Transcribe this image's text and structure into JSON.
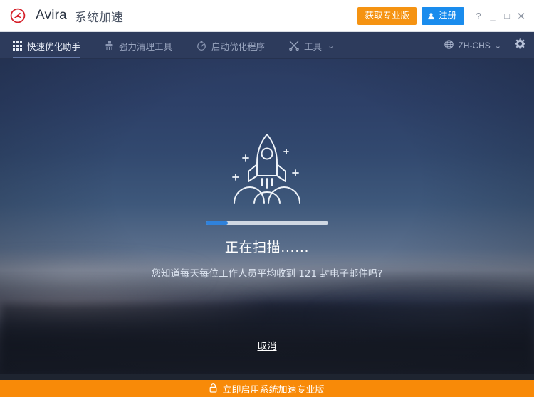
{
  "window": {
    "brand": "Avira",
    "product": "系统加速",
    "logo_icon": "avira-gauge-icon",
    "controls": {
      "help": "?",
      "minimize": "_",
      "maximize": "□",
      "close": "✕"
    },
    "buttons": {
      "get_pro": "获取专业版",
      "register": "注册",
      "register_icon": "user-icon"
    }
  },
  "nav": {
    "items": [
      {
        "label": "快速优化助手",
        "icon": "grid-dots-icon",
        "active": true
      },
      {
        "label": "强力清理工具",
        "icon": "brush-icon",
        "active": false
      },
      {
        "label": "启动优化程序",
        "icon": "stopwatch-icon",
        "active": false
      },
      {
        "label": "工具",
        "icon": "tools-icon",
        "active": false,
        "chevron": "⌄"
      }
    ],
    "language": {
      "label": "ZH-CHS",
      "icon": "globe-icon",
      "chevron": "⌄"
    },
    "settings_icon": "gear-icon"
  },
  "main": {
    "illustration": "rocket-launch-icon",
    "progress": {
      "percent": 18,
      "fill_color": "#2f82dc",
      "track_color": "#cfd8e3"
    },
    "status_title": "正在扫描......",
    "tip_text": "您知道每天每位工作人员平均收到 121 封电子邮件吗?",
    "cancel_label": "取消"
  },
  "footer": {
    "banner_label": "立即启用系统加速专业版",
    "banner_icon": "lock-icon",
    "banner_color": "#f88a08"
  }
}
